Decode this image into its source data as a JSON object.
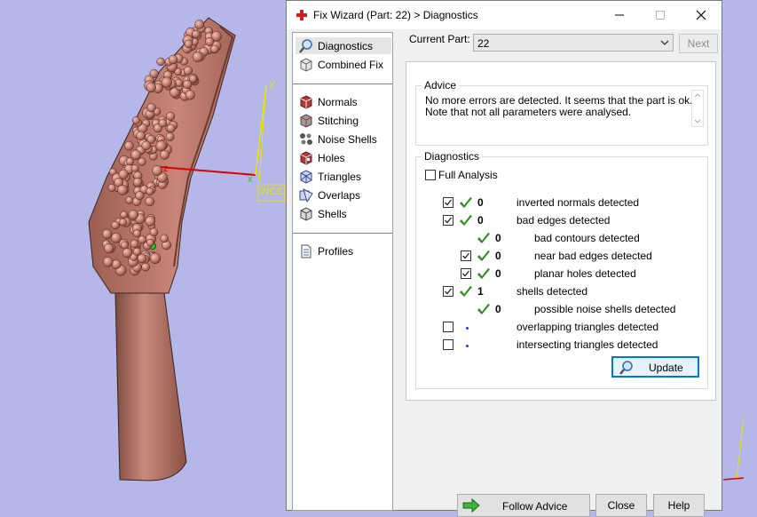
{
  "viewport": {
    "axis_z": "z",
    "axis_y": "y",
    "axis_x": "x",
    "wcs_label": "WCS"
  },
  "dialog": {
    "title": "Fix Wizard (Part: 22) > Diagnostics",
    "minimize_glyph": "—",
    "maximize_glyph": "☐",
    "close_glyph": "✕"
  },
  "nav": {
    "items": [
      {
        "label": "Diagnostics",
        "icon": "magnifier-icon",
        "selected": true
      },
      {
        "label": "Combined Fix",
        "icon": "cube-icon"
      },
      {
        "label": "Normals",
        "icon": "normals-cube-icon"
      },
      {
        "label": "Stitching",
        "icon": "stitching-cube-icon"
      },
      {
        "label": "Noise Shells",
        "icon": "noise-shells-icon"
      },
      {
        "label": "Holes",
        "icon": "holes-cube-icon"
      },
      {
        "label": "Triangles",
        "icon": "triangles-icon"
      },
      {
        "label": "Overlaps",
        "icon": "overlaps-icon"
      },
      {
        "label": "Shells",
        "icon": "shells-icon"
      },
      {
        "label": "Profiles",
        "icon": "document-icon"
      }
    ]
  },
  "current_part": {
    "label": "Current Part:",
    "value": "22",
    "next_label": "Next"
  },
  "advice": {
    "title": "Advice",
    "line1": "No more errors are detected. It seems that the part is ok.",
    "line2": "Note that not all parameters were analysed."
  },
  "diagnostics": {
    "title": "Diagnostics",
    "full_analysis": "Full Analysis",
    "rows": [
      {
        "checked": true,
        "status": "ok",
        "count": "0",
        "label": "inverted normals detected",
        "indent": false,
        "has_checkbox": true
      },
      {
        "checked": true,
        "status": "ok",
        "count": "0",
        "label": "bad edges detected",
        "indent": false,
        "has_checkbox": true
      },
      {
        "checked": false,
        "status": "ok",
        "count": "0",
        "label": "bad contours detected",
        "indent": true,
        "has_checkbox": false
      },
      {
        "checked": true,
        "status": "ok",
        "count": "0",
        "label": "near bad edges detected",
        "indent": true,
        "has_checkbox": true
      },
      {
        "checked": true,
        "status": "ok",
        "count": "0",
        "label": "planar holes detected",
        "indent": true,
        "has_checkbox": true
      },
      {
        "checked": true,
        "status": "ok",
        "count": "1",
        "label": "shells detected",
        "indent": false,
        "has_checkbox": true
      },
      {
        "checked": false,
        "status": "ok",
        "count": "0",
        "label": "possible noise shells detected",
        "indent": true,
        "has_checkbox": false
      },
      {
        "checked": false,
        "status": "pending",
        "count": "",
        "label": "overlapping triangles detected",
        "indent": false,
        "has_checkbox": true
      },
      {
        "checked": false,
        "status": "pending",
        "count": "",
        "label": "intersecting triangles detected",
        "indent": false,
        "has_checkbox": true
      }
    ],
    "update_label": "Update"
  },
  "footer": {
    "follow_advice_label": "Follow Advice",
    "close_label": "Close",
    "help_label": "Help"
  },
  "colors": {
    "model": "#c98578",
    "accent": "#0078d7",
    "check_green": "#2e8b1f"
  }
}
